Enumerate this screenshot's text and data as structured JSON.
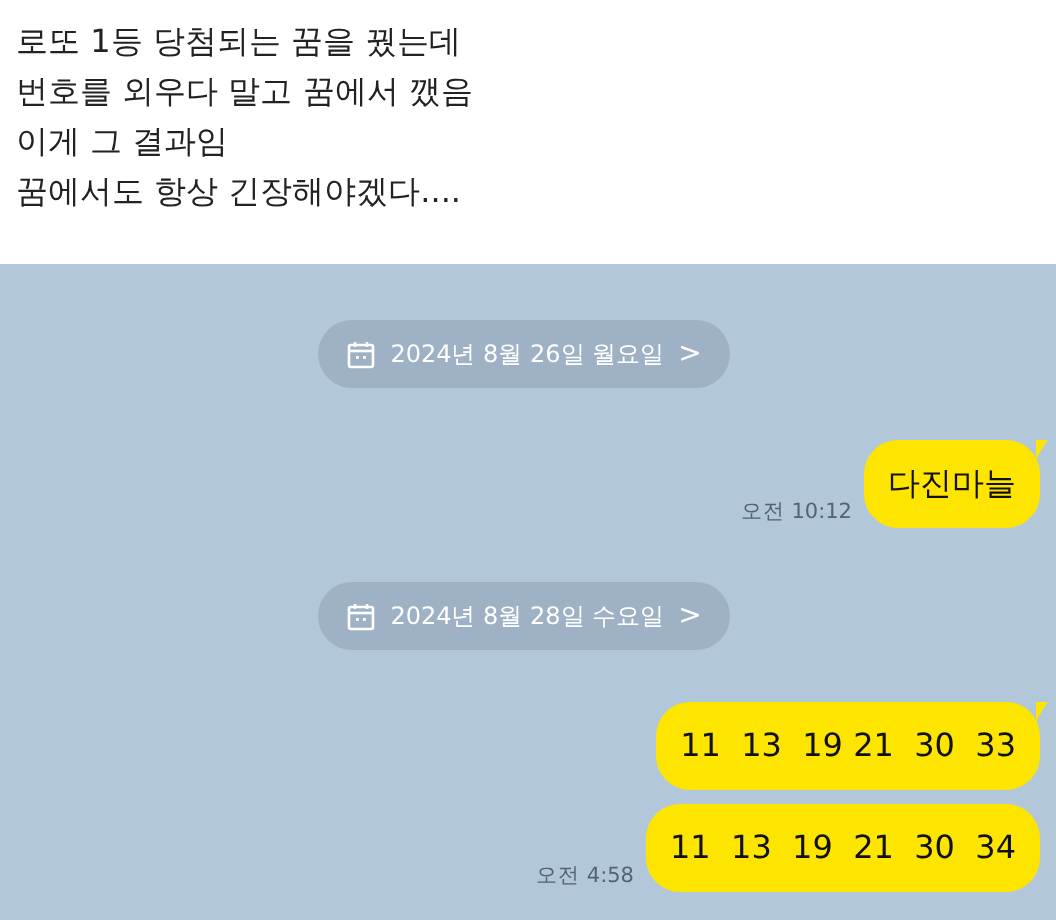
{
  "post": {
    "lines": [
      "로또 1등 당첨되는 꿈을 꿨는데",
      "번호를 외우다 말고 꿈에서 깼음",
      "이게 그 결과임",
      "꿈에서도 항상 긴장해야겠다...."
    ]
  },
  "chat": [
    {
      "kind": "date",
      "label": "2024년 8월 26일 월요일",
      "chevron": ">"
    },
    {
      "kind": "message",
      "text": "다진마늘",
      "time": "오전 10:12",
      "tail": true
    },
    {
      "kind": "date",
      "label": "2024년 8월 28일 수요일",
      "chevron": ">"
    },
    {
      "kind": "message",
      "text": "11  13  19 21  30  33",
      "tail": true
    },
    {
      "kind": "message",
      "text": "11  13  19  21  30  34",
      "time": "오전 4:58",
      "tail": false
    }
  ]
}
